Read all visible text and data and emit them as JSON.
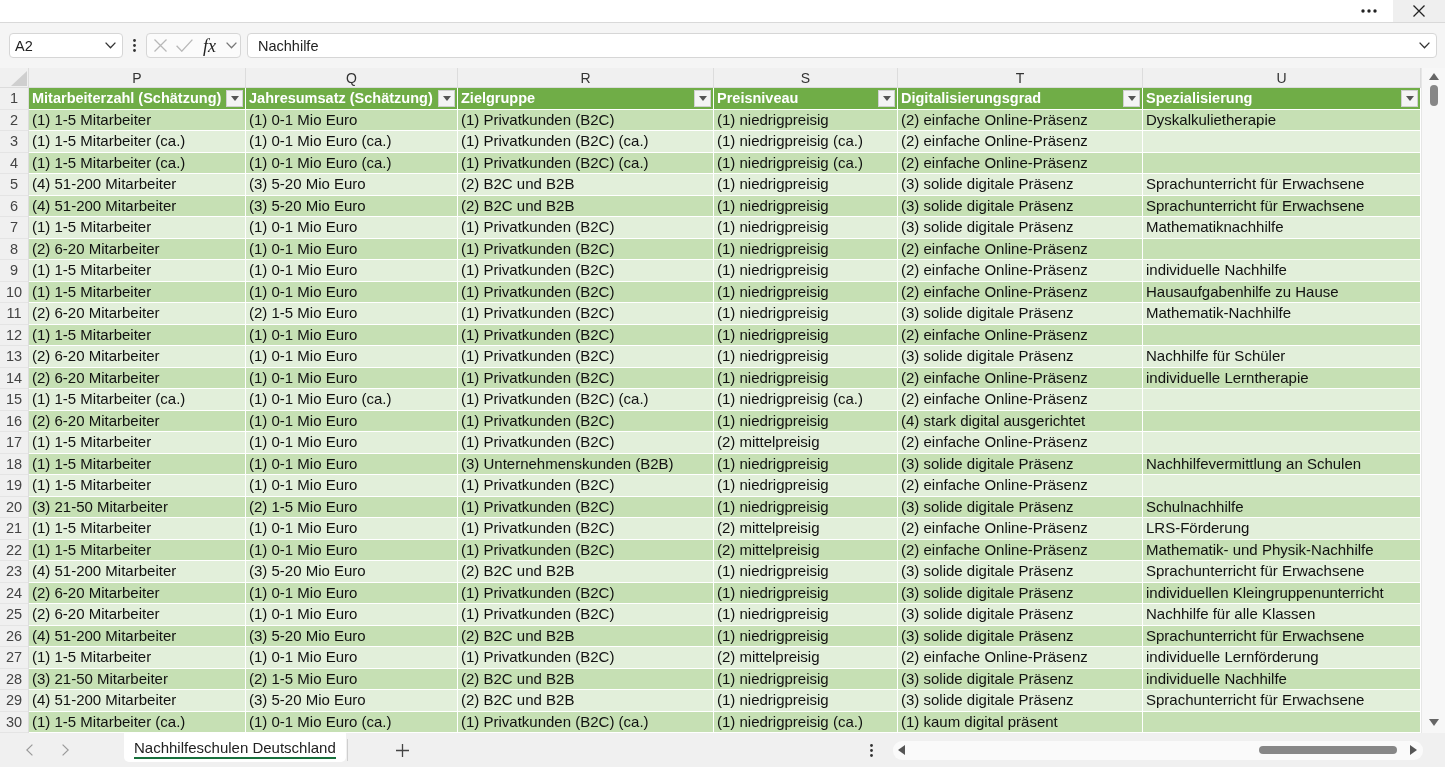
{
  "formula_bar": {
    "name_box": "A2",
    "edit_buttons_disabled": true,
    "function_label": "fx",
    "formula": "Nachhilfe"
  },
  "sheet": {
    "header_row_number": "1",
    "columns": [
      {
        "letter": "P",
        "title": "Mitarbeiterzahl (Schätzung)"
      },
      {
        "letter": "Q",
        "title": "Jahresumsatz (Schätzung)"
      },
      {
        "letter": "R",
        "title": "Zielgruppe"
      },
      {
        "letter": "S",
        "title": "Preisniveau"
      },
      {
        "letter": "T",
        "title": "Digitalisierungsgrad"
      },
      {
        "letter": "U",
        "title": "Spezialisierung"
      }
    ],
    "rows": [
      {
        "number": "2",
        "cells": {
          "P": "(1) 1-5 Mitarbeiter",
          "Q": "(1) 0-1 Mio Euro",
          "R": "(1) Privatkunden (B2C)",
          "S": "(1) niedrigpreisig",
          "T": "(2) einfache Online-Präsenz",
          "U": "Dyskalkulietherapie"
        }
      },
      {
        "number": "3",
        "cells": {
          "P": "(1) 1-5 Mitarbeiter (ca.)",
          "Q": "(1) 0-1 Mio Euro (ca.)",
          "R": "(1) Privatkunden (B2C) (ca.)",
          "S": "(1) niedrigpreisig (ca.)",
          "T": "(2) einfache Online-Präsenz"
        }
      },
      {
        "number": "4",
        "cells": {
          "P": "(1) 1-5 Mitarbeiter (ca.)",
          "Q": "(1) 0-1 Mio Euro (ca.)",
          "R": "(1) Privatkunden (B2C) (ca.)",
          "S": "(1) niedrigpreisig (ca.)",
          "T": "(2) einfache Online-Präsenz"
        }
      },
      {
        "number": "5",
        "cells": {
          "P": "(4) 51-200 Mitarbeiter",
          "Q": "(3) 5-20 Mio Euro",
          "R": "(2) B2C und B2B",
          "S": "(1) niedrigpreisig",
          "T": "(3) solide digitale Präsenz",
          "U": "Sprachunterricht für Erwachsene"
        }
      },
      {
        "number": "6",
        "cells": {
          "P": "(4) 51-200 Mitarbeiter",
          "Q": "(3) 5-20 Mio Euro",
          "R": "(2) B2C und B2B",
          "S": "(1) niedrigpreisig",
          "T": "(3) solide digitale Präsenz",
          "U": "Sprachunterricht für Erwachsene"
        }
      },
      {
        "number": "7",
        "cells": {
          "P": "(1) 1-5 Mitarbeiter",
          "Q": "(1) 0-1 Mio Euro",
          "R": "(1) Privatkunden (B2C)",
          "S": "(1) niedrigpreisig",
          "T": "(3) solide digitale Präsenz",
          "U": "Mathematiknachhilfe"
        }
      },
      {
        "number": "8",
        "cells": {
          "P": "(2) 6-20 Mitarbeiter",
          "Q": "(1) 0-1 Mio Euro",
          "R": "(1) Privatkunden (B2C)",
          "S": "(1) niedrigpreisig",
          "T": "(2) einfache Online-Präsenz"
        }
      },
      {
        "number": "9",
        "cells": {
          "P": "(1) 1-5 Mitarbeiter",
          "Q": "(1) 0-1 Mio Euro",
          "R": "(1) Privatkunden (B2C)",
          "S": "(1) niedrigpreisig",
          "T": "(2) einfache Online-Präsenz",
          "U": "individuelle Nachhilfe"
        }
      },
      {
        "number": "10",
        "cells": {
          "P": "(1) 1-5 Mitarbeiter",
          "Q": "(1) 0-1 Mio Euro",
          "R": "(1) Privatkunden (B2C)",
          "S": "(1) niedrigpreisig",
          "T": "(2) einfache Online-Präsenz",
          "U": "Hausaufgabenhilfe zu Hause"
        }
      },
      {
        "number": "11",
        "cells": {
          "P": "(2) 6-20 Mitarbeiter",
          "Q": "(2) 1-5 Mio Euro",
          "R": "(1) Privatkunden (B2C)",
          "S": "(1) niedrigpreisig",
          "T": "(3) solide digitale Präsenz",
          "U": "Mathematik-Nachhilfe"
        }
      },
      {
        "number": "12",
        "cells": {
          "P": "(1) 1-5 Mitarbeiter",
          "Q": "(1) 0-1 Mio Euro",
          "R": "(1) Privatkunden (B2C)",
          "S": "(1) niedrigpreisig",
          "T": "(2) einfache Online-Präsenz"
        }
      },
      {
        "number": "13",
        "cells": {
          "P": "(2) 6-20 Mitarbeiter",
          "Q": "(1) 0-1 Mio Euro",
          "R": "(1) Privatkunden (B2C)",
          "S": "(1) niedrigpreisig",
          "T": "(3) solide digitale Präsenz",
          "U": "Nachhilfe für Schüler"
        }
      },
      {
        "number": "14",
        "cells": {
          "P": "(2) 6-20 Mitarbeiter",
          "Q": "(1) 0-1 Mio Euro",
          "R": "(1) Privatkunden (B2C)",
          "S": "(1) niedrigpreisig",
          "T": "(2) einfache Online-Präsenz",
          "U": "individuelle Lerntherapie"
        }
      },
      {
        "number": "15",
        "cells": {
          "P": "(1) 1-5 Mitarbeiter (ca.)",
          "Q": "(1) 0-1 Mio Euro (ca.)",
          "R": "(1) Privatkunden (B2C) (ca.)",
          "S": "(1) niedrigpreisig (ca.)",
          "T": "(2) einfache Online-Präsenz"
        }
      },
      {
        "number": "16",
        "cells": {
          "P": "(2) 6-20 Mitarbeiter",
          "Q": "(1) 0-1 Mio Euro",
          "R": "(1) Privatkunden (B2C)",
          "S": "(1) niedrigpreisig",
          "T": "(4) stark digital ausgerichtet"
        }
      },
      {
        "number": "17",
        "cells": {
          "P": "(1) 1-5 Mitarbeiter",
          "Q": "(1) 0-1 Mio Euro",
          "R": "(1) Privatkunden (B2C)",
          "S": "(2) mittelpreisig",
          "T": "(2) einfache Online-Präsenz"
        }
      },
      {
        "number": "18",
        "cells": {
          "P": "(1) 1-5 Mitarbeiter",
          "Q": "(1) 0-1 Mio Euro",
          "R": "(3) Unternehmenskunden (B2B)",
          "S": "(1) niedrigpreisig",
          "T": "(3) solide digitale Präsenz",
          "U": "Nachhilfevermittlung an Schulen"
        }
      },
      {
        "number": "19",
        "cells": {
          "P": "(1) 1-5 Mitarbeiter",
          "Q": "(1) 0-1 Mio Euro",
          "R": "(1) Privatkunden (B2C)",
          "S": "(1) niedrigpreisig",
          "T": "(2) einfache Online-Präsenz"
        }
      },
      {
        "number": "20",
        "cells": {
          "P": "(3) 21-50 Mitarbeiter",
          "Q": "(2) 1-5 Mio Euro",
          "R": "(1) Privatkunden (B2C)",
          "S": "(1) niedrigpreisig",
          "T": "(3) solide digitale Präsenz",
          "U": "Schulnachhilfe"
        }
      },
      {
        "number": "21",
        "cells": {
          "P": "(1) 1-5 Mitarbeiter",
          "Q": "(1) 0-1 Mio Euro",
          "R": "(1) Privatkunden (B2C)",
          "S": "(2) mittelpreisig",
          "T": "(2) einfache Online-Präsenz",
          "U": "LRS-Förderung"
        }
      },
      {
        "number": "22",
        "cells": {
          "P": "(1) 1-5 Mitarbeiter",
          "Q": "(1) 0-1 Mio Euro",
          "R": "(1) Privatkunden (B2C)",
          "S": "(2) mittelpreisig",
          "T": "(2) einfache Online-Präsenz",
          "U": "Mathematik- und Physik-Nachhilfe"
        }
      },
      {
        "number": "23",
        "cells": {
          "P": "(4) 51-200 Mitarbeiter",
          "Q": "(3) 5-20 Mio Euro",
          "R": "(2) B2C und B2B",
          "S": "(1) niedrigpreisig",
          "T": "(3) solide digitale Präsenz",
          "U": "Sprachunterricht für Erwachsene"
        }
      },
      {
        "number": "24",
        "cells": {
          "P": "(2) 6-20 Mitarbeiter",
          "Q": "(1) 0-1 Mio Euro",
          "R": "(1) Privatkunden (B2C)",
          "S": "(1) niedrigpreisig",
          "T": "(3) solide digitale Präsenz",
          "U": "individuellen Kleingruppenunterricht"
        }
      },
      {
        "number": "25",
        "cells": {
          "P": "(2) 6-20 Mitarbeiter",
          "Q": "(1) 0-1 Mio Euro",
          "R": "(1) Privatkunden (B2C)",
          "S": "(1) niedrigpreisig",
          "T": "(3) solide digitale Präsenz",
          "U": "Nachhilfe für alle Klassen"
        }
      },
      {
        "number": "26",
        "cells": {
          "P": "(4) 51-200 Mitarbeiter",
          "Q": "(3) 5-20 Mio Euro",
          "R": "(2) B2C und B2B",
          "S": "(1) niedrigpreisig",
          "T": "(3) solide digitale Präsenz",
          "U": "Sprachunterricht für Erwachsene"
        }
      },
      {
        "number": "27",
        "cells": {
          "P": "(1) 1-5 Mitarbeiter",
          "Q": "(1) 0-1 Mio Euro",
          "R": "(1) Privatkunden (B2C)",
          "S": "(2) mittelpreisig",
          "T": "(2) einfache Online-Präsenz",
          "U": "individuelle Lernförderung"
        }
      },
      {
        "number": "28",
        "cells": {
          "P": "(3) 21-50 Mitarbeiter",
          "Q": "(2) 1-5 Mio Euro",
          "R": "(2) B2C und B2B",
          "S": "(1) niedrigpreisig",
          "T": "(3) solide digitale Präsenz",
          "U": "individuelle Nachhilfe"
        }
      },
      {
        "number": "29",
        "cells": {
          "P": "(4) 51-200 Mitarbeiter",
          "Q": "(3) 5-20 Mio Euro",
          "R": "(2) B2C und B2B",
          "S": "(1) niedrigpreisig",
          "T": "(3) solide digitale Präsenz",
          "U": "Sprachunterricht für Erwachsene"
        }
      },
      {
        "number": "30",
        "cells": {
          "P": "(1) 1-5 Mitarbeiter (ca.)",
          "Q": "(1) 0-1 Mio Euro (ca.)",
          "R": "(1) Privatkunden (B2C) (ca.)",
          "S": "(1) niedrigpreisig (ca.)",
          "T": "(1) kaum digital präsent"
        }
      }
    ]
  },
  "sheet_tabs": [
    {
      "label": "Nachhilfeschulen Deutschland",
      "selected": true
    }
  ]
}
